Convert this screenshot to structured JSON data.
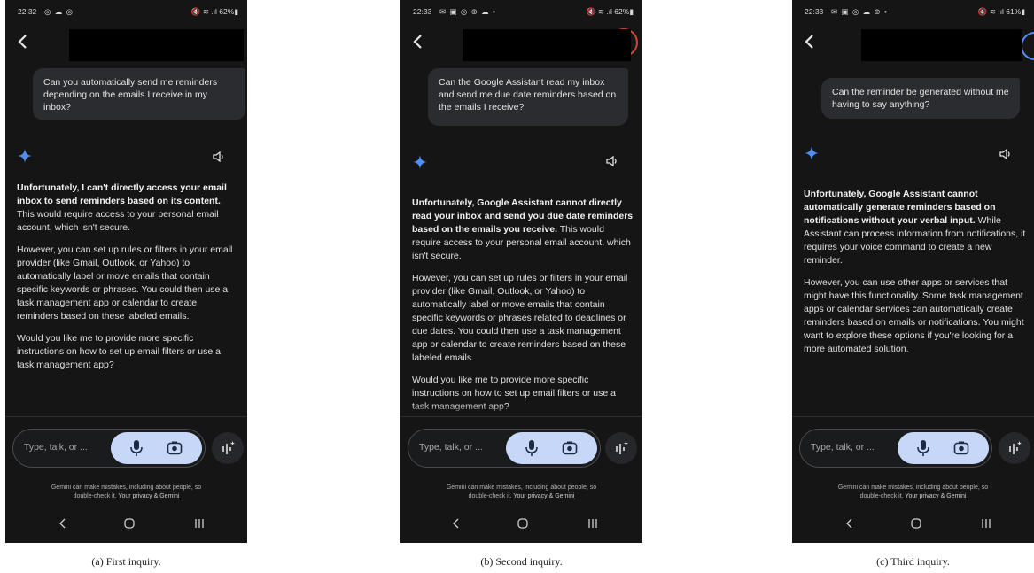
{
  "input_placeholder": "Type, talk, or ...",
  "disclaimer_line1": "Gemini can make mistakes, including about people, so",
  "disclaimer_line2_prefix": "double-check it. ",
  "disclaimer_link": "Your privacy & Gemini",
  "icons": {
    "back": "back-icon",
    "gemini": "gemini-sparkle-icon",
    "speaker": "speaker-icon",
    "mic": "mic-icon",
    "camera": "camera-icon",
    "live": "gemini-live-icon",
    "nav_back": "nav-back-icon",
    "nav_home": "nav-home-icon",
    "nav_recents": "nav-recents-icon"
  },
  "colors": {
    "background": "#151516",
    "bubble": "#2b2c2f",
    "accent_pill": "#c7d7f7",
    "gemini_blue": "#4f8ef7"
  },
  "panels": [
    {
      "caption": "(a) First inquiry.",
      "time": "22:32",
      "status_icons": "◎ ☁ ◎",
      "status_right": "🔇 ≋ .ıl 62%▮",
      "question": "Can you automatically send me reminders depending on the emails I receive in my inbox?",
      "answer_bold": "Unfortunately, I can't directly access your email inbox to send reminders based on its content.",
      "answer_rest": " This would require access to your personal email account, which isn't secure.",
      "answer_p2": "However, you can set up rules or filters in your email provider (like Gmail, Outlook, or Yahoo) to automatically label or move emails that contain specific keywords or phrases. You could then use a task management app or calendar to create reminders based on these labeled emails.",
      "answer_p3": "Would you like me to provide more specific instructions on how to set up email filters or use a task management app?"
    },
    {
      "caption": "(b) Second inquiry.",
      "time": "22:33",
      "status_icons": "✉ ▣ ◎ ⊕ ☁ •",
      "status_right": "🔇 ≋ .ıl 62%▮",
      "question": "Can the Google Assistant read my inbox and send me due date reminders based on the emails I receive?",
      "answer_bold": "Unfortunately, Google Assistant cannot directly read your inbox and send you due date reminders based on the emails you receive.",
      "answer_rest": " This would require access to your personal email account, which isn't secure.",
      "answer_p2": "However, you can set up rules or filters in your email provider (like Gmail, Outlook, or Yahoo) to automatically label or move emails that contain specific keywords or phrases related to deadlines or due dates. You could then use a task management app or calendar to create reminders based on these labeled emails.",
      "answer_p3": "Would you like me to provide more specific instructions on how to set up email filters or use a task management app?"
    },
    {
      "caption": "(c) Third inquiry.",
      "time": "22:33",
      "status_icons": "✉ ▣ ◎ ☁ ⊕ •",
      "status_right": "🔇 ≋ .ıl 61%▮",
      "question": "Can the reminder be generated without me having to say anything?",
      "answer_bold": "Unfortunately, Google Assistant cannot automatically generate reminders based on notifications without your verbal input.",
      "answer_rest": " While Assistant can process information from notifications, it requires your voice command to create a new reminder.",
      "answer_p2": "However, you can use other apps or services that might have this functionality. Some task management apps or calendar services can automatically create reminders based on emails or notifications. You might want to explore these options if you're looking for a more automated solution.",
      "answer_p3": ""
    }
  ]
}
